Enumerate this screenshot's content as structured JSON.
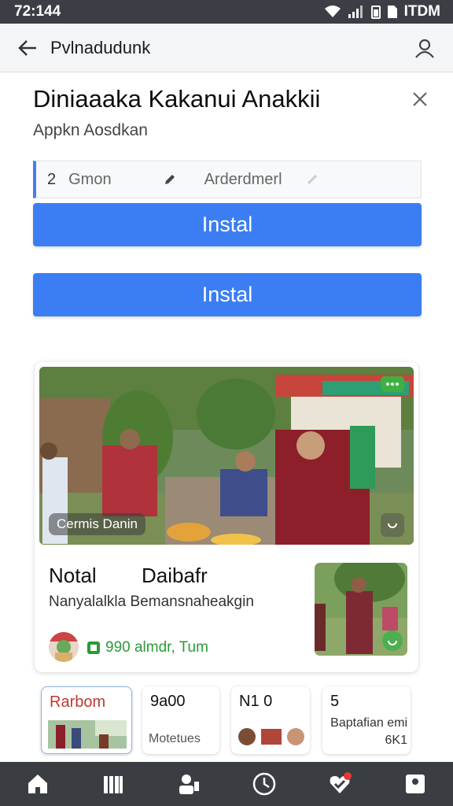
{
  "status_bar": {
    "time": "72:144",
    "right_text": "ITDM"
  },
  "app_bar": {
    "title": "Pvlnadudunk"
  },
  "heading": "Diniaaaka Kakanui Anakkii",
  "subheading": "Appkn Aosdkan",
  "fields": {
    "value": "2",
    "placeholder": "Gmon",
    "placeholder2": "Arderdmerl"
  },
  "buttons": {
    "install_1": "Instal",
    "install_2": "Instal"
  },
  "card": {
    "caption": "Cermis Danin",
    "title_1": "Notal",
    "title_2": "Daibafr",
    "description": "Nanyalalkla Bemansnaheakgin",
    "meta": "990 almdr, Tum"
  },
  "stats": [
    {
      "value": "Rarbom",
      "label": ""
    },
    {
      "value": "9a00",
      "label": "Motetues"
    },
    {
      "value": "N1 0",
      "label": ""
    },
    {
      "value": "5",
      "label": "Baptafian emi 6K1"
    }
  ],
  "bottom_nav": [
    "home-icon",
    "library-icon",
    "people-icon",
    "clock-icon",
    "heart-badge-icon",
    "profile-icon"
  ]
}
